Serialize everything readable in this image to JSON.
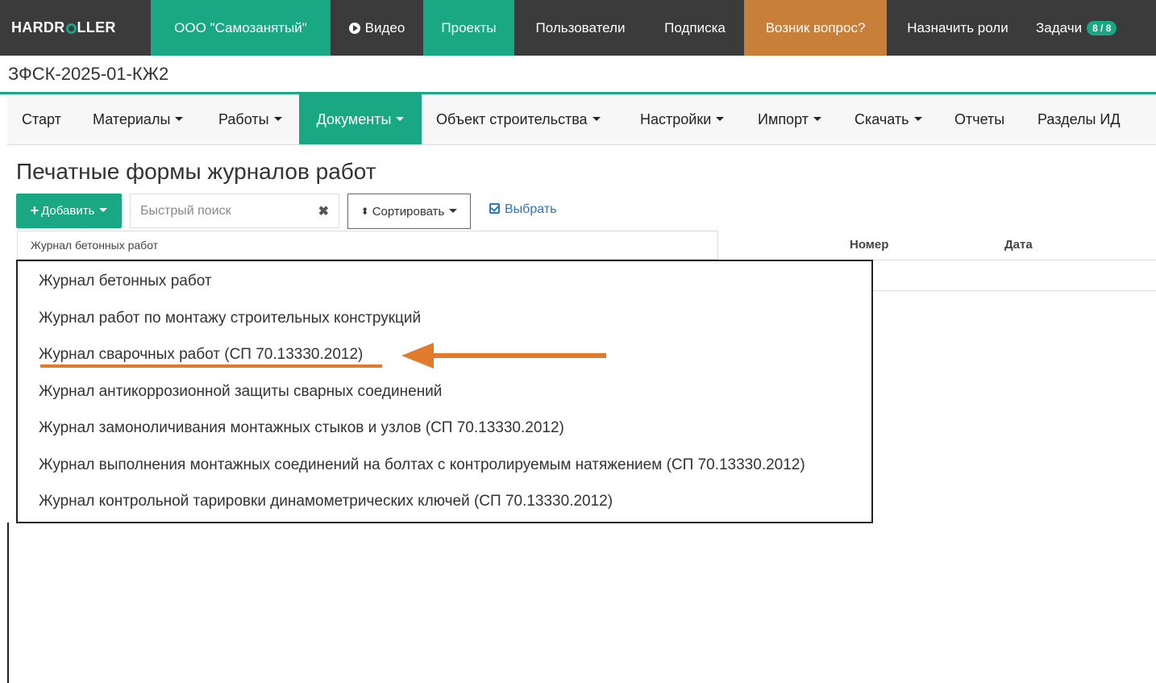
{
  "topnav": {
    "brand": "HARDROLLER",
    "company": "ООО \"Самозанятый\"",
    "video": "Видео",
    "projects": "Проекты",
    "users": "Пользователи",
    "subscription": "Подписка",
    "question": "Возник вопрос?",
    "assign_roles": "Назначить роли",
    "tasks": "Задачи",
    "tasks_badge": "8 / 8"
  },
  "project_code": "ЗФСК-2025-01-КЖ2",
  "menu": {
    "start": "Старт",
    "materials": "Материалы",
    "works": "Работы",
    "documents": "Документы",
    "object": "Объект строительства",
    "settings": "Настройки",
    "import": "Импорт",
    "download": "Скачать",
    "reports": "Отчеты",
    "sections": "Разделы ИД"
  },
  "page_title": "Печатные формы журналов работ",
  "toolbar": {
    "add": "Добавить",
    "search_placeholder": "Быстрый поиск",
    "sort": "Сортировать",
    "select": "Выбрать"
  },
  "table": {
    "selected_journal": "Журнал бетонных работ",
    "col_number": "Номер",
    "col_date": "Дата"
  },
  "dropdown_items": [
    "Журнал бетонных работ",
    "Журнал работ по монтажу строительных конструкций",
    "Журнал сварочных работ (СП 70.13330.2012)",
    "Журнал антикоррозионной защиты сварных соединений",
    "Журнал замоноличивания монтажных стыков и узлов (СП 70.13330.2012)",
    "Журнал выполнения монтажных соединений на болтах с контролируемым натяжением (СП 70.13330.2012)",
    "Журнал контрольной тарировки динамометрических ключей (СП 70.13330.2012)"
  ],
  "colors": {
    "primary_green": "#1aa783",
    "navbar_dark": "#3b3b3b",
    "question_orange": "#c87f3a",
    "highlight_arrow": "#e07a2c"
  }
}
